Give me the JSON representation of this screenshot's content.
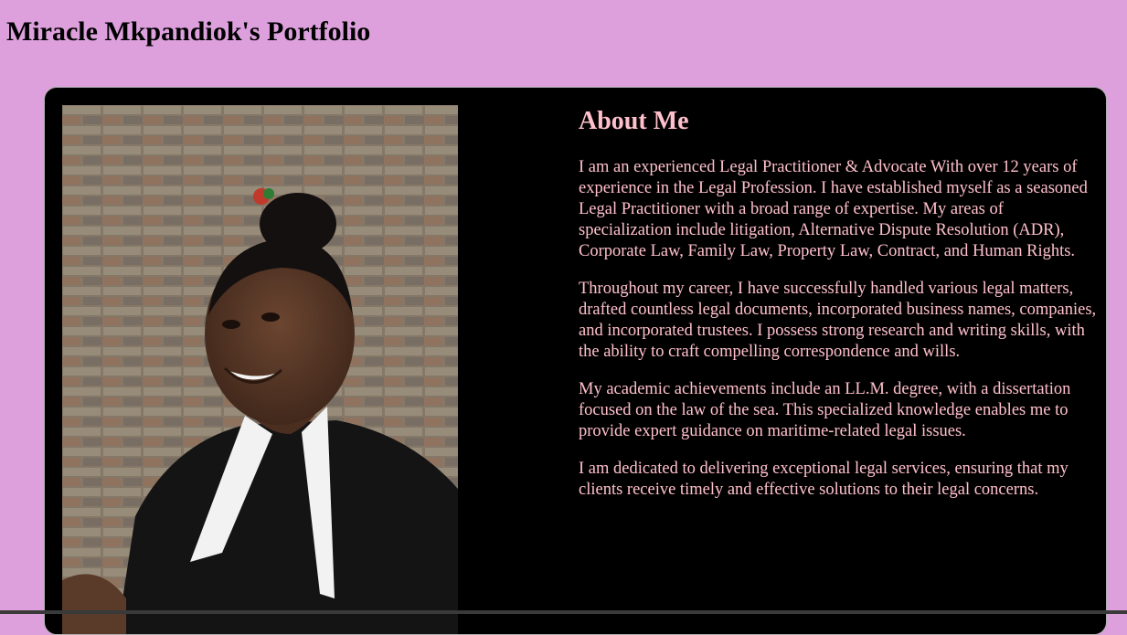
{
  "header": {
    "title": "Miracle Mkpandiok's Portfolio"
  },
  "about": {
    "heading": "About Me",
    "paragraphs": [
      "I am an experienced Legal Practitioner & Advocate With over 12 years of experience in the Legal Profession. I have established myself as a seasoned Legal Practitioner with a broad range of expertise. My areas of specialization include litigation, Alternative Dispute Resolution (ADR), Corporate Law, Family Law, Property Law, Contract, and Human Rights.",
      "Throughout my career, I have successfully handled various legal matters, drafted countless legal documents, incorporated business names, companies, and incorporated trustees. I possess strong research and writing skills, with the ability to craft compelling correspondence and wills.",
      "My academic achievements include an LL.M. degree, with a dissertation focused on the law of the sea. This specialized knowledge enables me to provide expert guidance on maritime-related legal issues.",
      "I am dedicated to delivering exceptional legal services, ensuring that my clients receive timely and effective solutions to their legal concerns."
    ]
  },
  "colors": {
    "page_background": "#dda0dd",
    "card_background": "#000000",
    "about_text": "#ffc0cb",
    "title_text": "#000000"
  }
}
